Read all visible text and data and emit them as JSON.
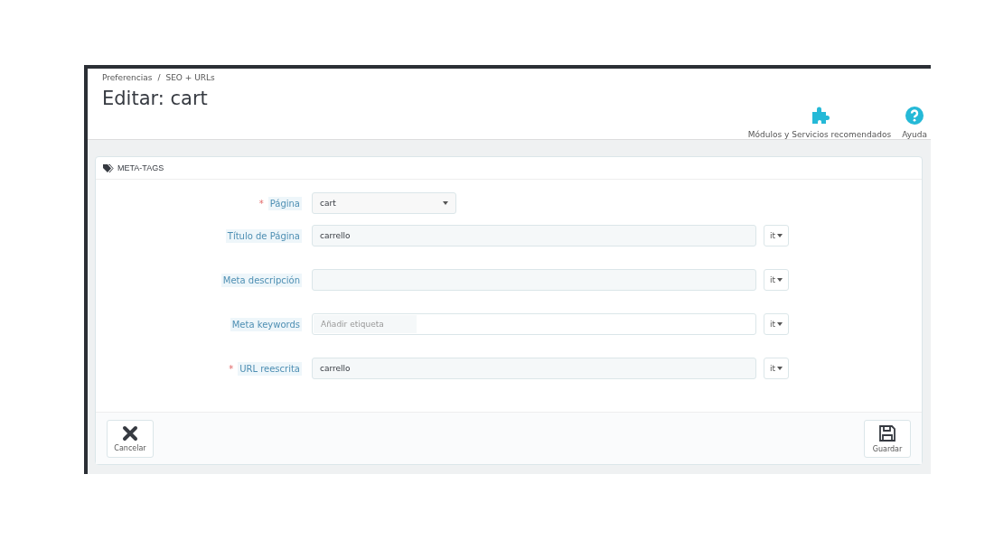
{
  "breadcrumb": {
    "items": [
      "Preferencias",
      "SEO + URLs"
    ],
    "separator": "/"
  },
  "page_title": "Editar: cart",
  "toolbar": [
    {
      "kind": "puzzle",
      "label": "Módulos y Servicios recomendados"
    },
    {
      "kind": "help",
      "label": "Ayuda"
    }
  ],
  "panel": {
    "heading": "META-TAGS",
    "fields": [
      {
        "kind": "select",
        "label": "Página",
        "required_mark": "*",
        "value": "cart"
      },
      {
        "kind": "text",
        "label": "Título de Página",
        "value": "carrello",
        "lang": "it"
      },
      {
        "kind": "text",
        "label": "Meta descripción",
        "lang": "it"
      },
      {
        "kind": "tags",
        "label": "Meta keywords",
        "placeholder": "Añadir etiqueta",
        "lang": "it"
      },
      {
        "kind": "text",
        "label": "URL reescrita",
        "required_mark": "*",
        "value": "carrello",
        "lang": "it"
      }
    ],
    "buttons": [
      {
        "kind": "cancel",
        "label": "Cancelar"
      },
      {
        "kind": "save",
        "label": "Guardar"
      }
    ]
  }
}
